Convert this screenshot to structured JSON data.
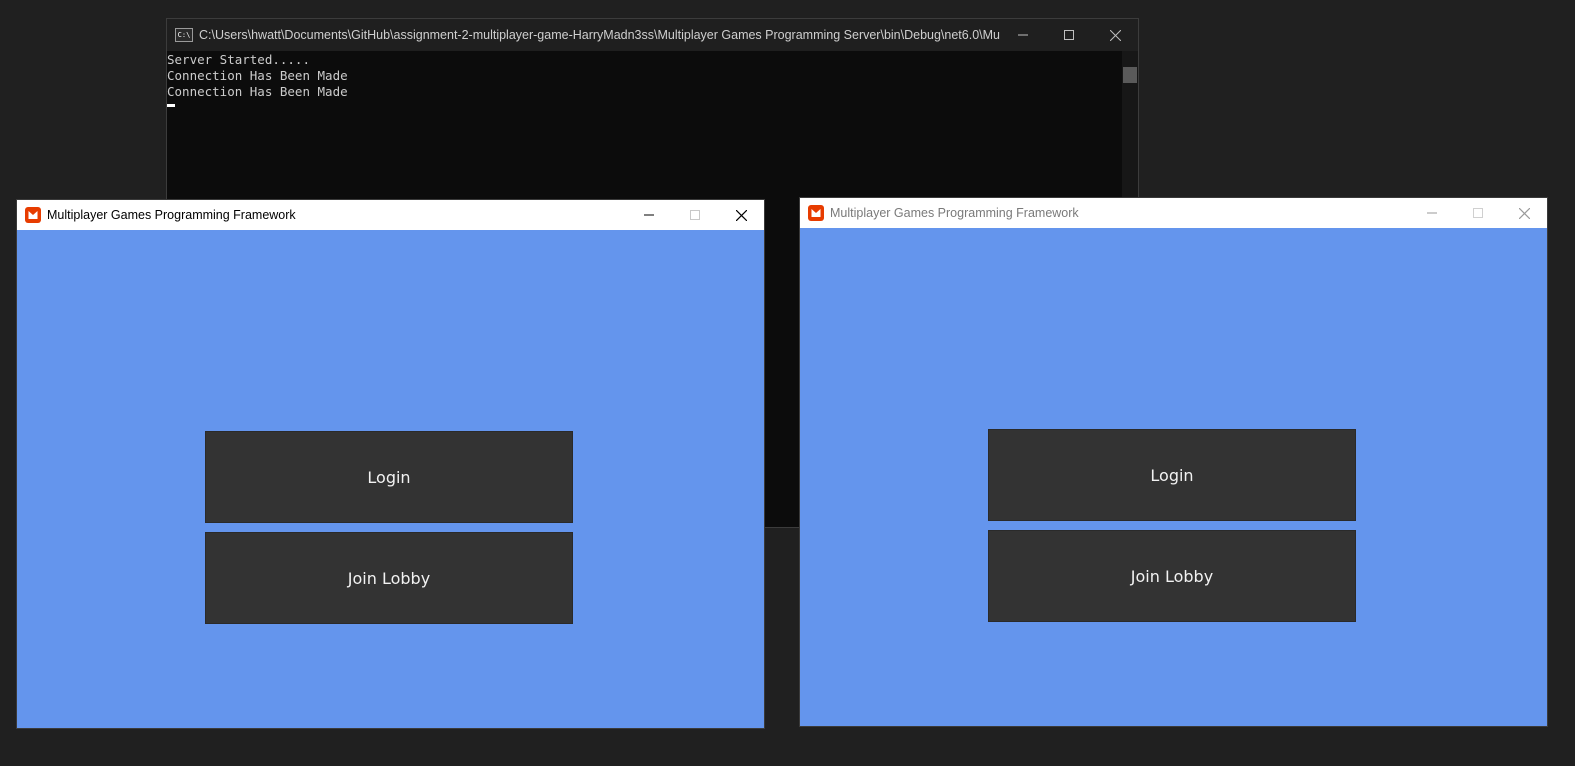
{
  "console": {
    "title": "C:\\Users\\hwatt\\Documents\\GitHub\\assignment-2-multiplayer-game-HarryMadn3ss\\Multiplayer Games Programming Server\\bin\\Debug\\net6.0\\Multi...",
    "icon": "console-app-icon",
    "icon_text": "C:\\",
    "lines": [
      "Server Started.....",
      "Connection Has Been Made",
      "Connection Has Been Made"
    ],
    "background": "#0c0c0c",
    "text_color": "#cccccc"
  },
  "game_windows": [
    {
      "title": "Multiplayer Games Programming Framework",
      "active": true,
      "buttons": {
        "login": "Login",
        "join_lobby": "Join Lobby"
      }
    },
    {
      "title": "Multiplayer Games Programming Framework",
      "active": false,
      "buttons": {
        "login": "Login",
        "join_lobby": "Join Lobby"
      }
    }
  ],
  "colors": {
    "desktop": "#202020",
    "game_background": "#6495ed",
    "button_background": "#333333",
    "button_text": "#f2f2f2",
    "logo": "#e73c00"
  },
  "icons": {
    "minimize": "minimize-icon",
    "maximize": "maximize-icon",
    "close": "close-icon",
    "logo": "monogame-logo-icon"
  }
}
